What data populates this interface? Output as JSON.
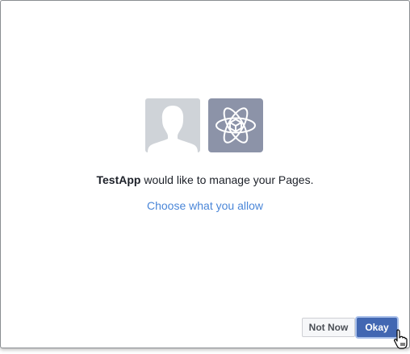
{
  "dialog": {
    "app_name": "TestApp",
    "message_rest": " would like to manage your Pages.",
    "choose_link": "Choose what you allow",
    "buttons": {
      "not_now": "Not Now",
      "okay": "Okay"
    }
  },
  "icons": {
    "avatar": "user-silhouette-icon",
    "app": "atom-icon",
    "cursor": "hand-pointer-cursor-icon"
  },
  "colors": {
    "accent": "#4267b2",
    "link": "#4a86d8",
    "avatar_bg": "#cfd3d8",
    "app_icon_bg": "#8c93a8"
  }
}
